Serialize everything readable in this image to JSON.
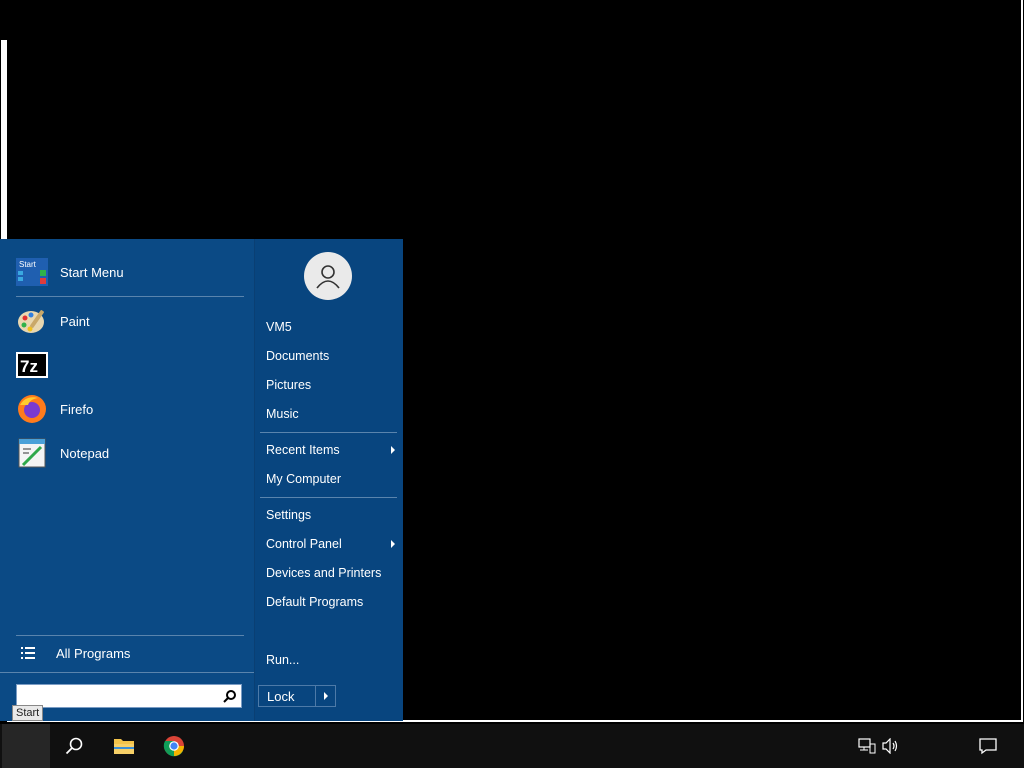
{
  "start_menu": {
    "pinned": [
      {
        "label": "Start Menu",
        "icon": "start-menu-app-icon"
      },
      {
        "label": "Paint",
        "icon": "paint-icon"
      },
      {
        "label": "",
        "icon": "7zip-icon"
      },
      {
        "label": "Firefo",
        "icon": "firefox-icon"
      },
      {
        "label": "Notepad",
        "icon": "notepad-icon"
      }
    ],
    "start_icon_text": "Start",
    "all_programs_label": "All Programs",
    "search": {
      "value": "",
      "placeholder": ""
    },
    "tooltip": "Start",
    "right": {
      "user": "VM5",
      "items": [
        {
          "label": "Documents"
        },
        {
          "label": "Pictures"
        },
        {
          "label": "Music"
        },
        {
          "label": "Recent Items"
        },
        {
          "label": "My Computer"
        },
        {
          "label": "Settings"
        },
        {
          "label": "Control Panel"
        },
        {
          "label": "Devices and Printers"
        },
        {
          "label": "Default Programs"
        },
        {
          "label": "Run..."
        }
      ],
      "lock_label": "Lock"
    }
  },
  "colors": {
    "menu_bg": "#0b4a85",
    "taskbar_bg": "#101010",
    "accent_folder": "#f3c34a"
  }
}
